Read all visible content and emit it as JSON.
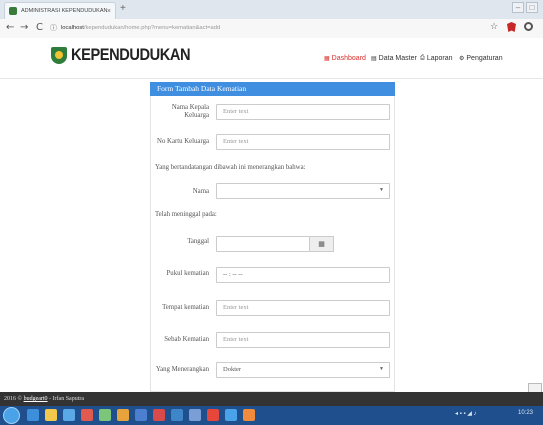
{
  "browser": {
    "tab_title": "ADMINISTRASI KEPENDUDUKAN",
    "tab_close": "×",
    "new_tab": "+",
    "back": "←",
    "forward": "→",
    "reload": "C",
    "url_host": "localhost",
    "url_path": "/kependudukan/home.php?menu=kematian&act=add",
    "star": "☆",
    "win_min": "–",
    "win_max": "□"
  },
  "site": {
    "brand": "KEPENDUDUKAN",
    "nav": [
      {
        "label": "Dashboard",
        "icon": "▦"
      },
      {
        "label": "Data Master",
        "icon": "▤"
      },
      {
        "label": "Laporan",
        "icon": "⎙"
      },
      {
        "label": "Pengaturan",
        "icon": "⚙"
      }
    ]
  },
  "form": {
    "title": "Form Tambah Data Kematian",
    "nama_kk_label": "Nama Kepala Keluarga",
    "nama_kk_placeholder": "Enter text",
    "no_kk_label": "No Kartu Keluarga",
    "no_kk_placeholder": "Enter text",
    "declaration": "Yang bertandatangan dibawah ini menerangkan bahwa:",
    "nama_label": "Nama",
    "nama_value": "",
    "meninggal_label": "Telah meninggal pada:",
    "tanggal_label": "Tanggal",
    "tanggal_value": "",
    "pukul_label": "Pukul kematian",
    "pukul_value": "-- : -- --",
    "tempat_label": "Tempat kematian",
    "tempat_placeholder": "Enter text",
    "sebab_label": "Sebab Kematian",
    "sebab_placeholder": "Enter text",
    "yang_menerangkan_label": "Yang Menerangkan",
    "yang_menerangkan_value": "Dokter"
  },
  "footer": {
    "prefix": "2016 © ",
    "link": "budgeart0",
    "suffix": " - Irfan Saputra"
  },
  "taskbar": {
    "time": "10:23"
  }
}
